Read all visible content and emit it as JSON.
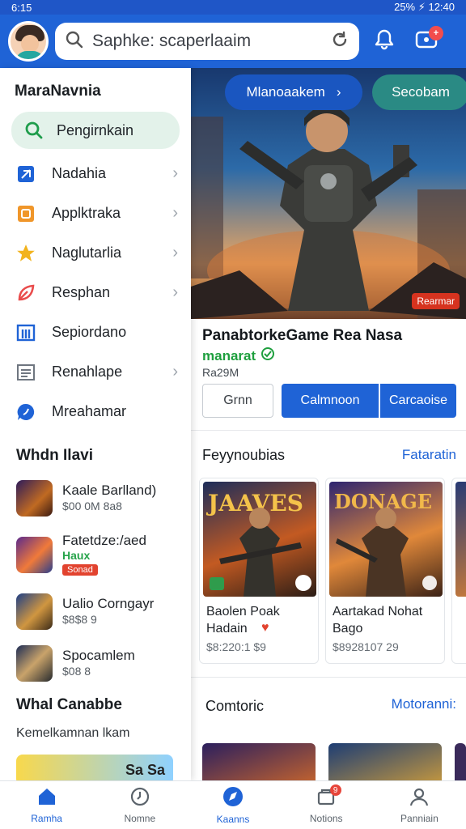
{
  "status_bar": {
    "time_left": "6:15",
    "right": "25% ⚡ 12:40"
  },
  "header": {
    "search_placeholder": "Saphke: scaperlaaim"
  },
  "drawer": {
    "title": "MaraNavnia",
    "items": [
      {
        "label": "Pengirnkain",
        "icon": "search-icon",
        "color": "#1f9d4c",
        "active": true
      },
      {
        "label": "Nadahia",
        "icon": "puzzle-icon",
        "color": "#1f63d6"
      },
      {
        "label": "Applktraka",
        "icon": "app-icon",
        "color": "#f0962a"
      },
      {
        "label": "Naglutarlia",
        "icon": "star-icon",
        "color": "#f2b31d"
      },
      {
        "label": "Resphan",
        "icon": "leaf-icon",
        "color": "#e94c4c"
      },
      {
        "label": "Sepiordano",
        "icon": "grid-icon",
        "color": "#1f63d6"
      },
      {
        "label": "Renahlape",
        "icon": "list-icon",
        "color": "#6f7680"
      },
      {
        "label": "Mreahamar",
        "icon": "chat-icon",
        "color": "#1f63d6"
      }
    ],
    "section_title": "Whdn Ilavi",
    "games": [
      {
        "name": "Kaale Barlland)",
        "meta": "$00 0M 8a8"
      },
      {
        "name": "Fatetdze:/aed",
        "tag": "Haux",
        "badge": "Sonad"
      },
      {
        "name": "Ualio Corngayr",
        "meta": "$8$8 9"
      },
      {
        "name": "Spocamlem",
        "meta": "$08 8"
      }
    ],
    "section2_title": "Whal Canabbe",
    "foot_note": "Kemelkamnan lkam",
    "promo_text": "Sa Sa"
  },
  "hero": {
    "pill_1": "Mlanoaakem",
    "pill_2": "Secobam",
    "badge": "Rearmar"
  },
  "featured": {
    "title": "PanabtorkeGame Rea Nasa",
    "developer": "manarat",
    "size": "Ra29M",
    "btn_secondary": "Grnn",
    "btn_primary": "Calmnoon",
    "btn_primary2": "Carcaoise"
  },
  "section1": {
    "title": "Feyynoubias",
    "link": "Fataratin",
    "cards": [
      {
        "name": "Baolen Poak Hadain",
        "meta": "$8:220:1 $9",
        "art_text": "JAAVES",
        "heart": true
      },
      {
        "name": "Aartakad Nohat Bago",
        "meta": "$8928107 29",
        "art_text": "DONAGE"
      }
    ]
  },
  "section2": {
    "title": "Comtoric",
    "link": "Motoranni:"
  },
  "bottom_nav": [
    {
      "label": "Ramha",
      "icon": "home-icon",
      "active": true
    },
    {
      "label": "Nomne",
      "icon": "clock-icon"
    },
    {
      "label": "Kaanns",
      "icon": "compass-icon",
      "active": true
    },
    {
      "label": "Notions",
      "icon": "bell-icon",
      "badge": "9"
    },
    {
      "label": "Panniain",
      "icon": "person-icon"
    }
  ],
  "colors": {
    "brand": "#1f63d6",
    "accent_green": "#1e9f3e",
    "danger": "#e2432f"
  }
}
